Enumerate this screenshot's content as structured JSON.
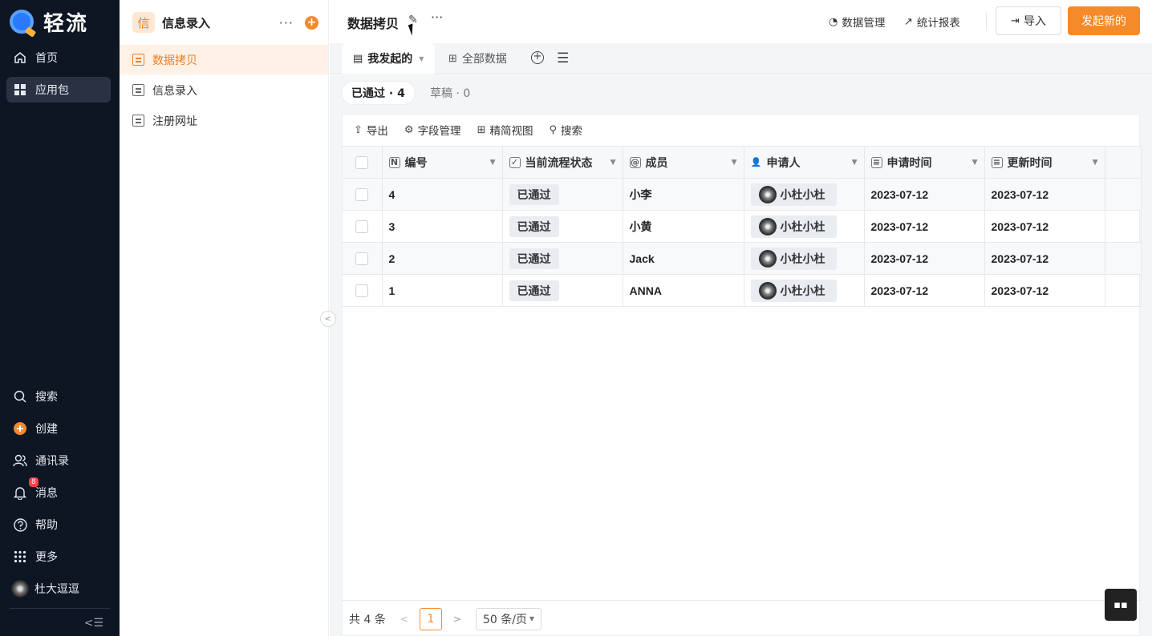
{
  "brand": {
    "name": "轻流"
  },
  "nav": {
    "items": [
      {
        "label": "首页",
        "icon": "home-icon"
      },
      {
        "label": "应用包",
        "icon": "grid-icon",
        "active": true
      }
    ],
    "bottom": [
      {
        "label": "搜索",
        "icon": "search-icon"
      },
      {
        "label": "创建",
        "icon": "plus-circle-icon"
      },
      {
        "label": "通讯录",
        "icon": "contacts-icon"
      },
      {
        "label": "消息",
        "icon": "bell-icon",
        "badge": "8"
      },
      {
        "label": "帮助",
        "icon": "help-icon"
      },
      {
        "label": "更多",
        "icon": "apps-icon"
      },
      {
        "label": "杜大逗逗",
        "icon": "avatar"
      }
    ]
  },
  "side": {
    "app_icon": "信",
    "title": "信息录入",
    "items": [
      {
        "label": "数据拷贝",
        "active": true
      },
      {
        "label": "信息录入"
      },
      {
        "label": "注册网址"
      }
    ]
  },
  "topbar": {
    "title": "数据拷贝",
    "data_manage": "数据管理",
    "report": "统计报表",
    "import": "导入",
    "new": "发起新的"
  },
  "tabs": [
    {
      "label": "我发起的",
      "active": true
    },
    {
      "label": "全部数据"
    }
  ],
  "chips": {
    "approved": "已通过 · 4",
    "draft": "草稿 · 0"
  },
  "toolbar": {
    "export": "导出",
    "fields": "字段管理",
    "simple_view": "精简视图",
    "search": "搜索"
  },
  "table": {
    "headers": [
      "编号",
      "当前流程状态",
      "成员",
      "申请人",
      "申请时间",
      "更新时间"
    ],
    "rows": [
      {
        "id": "4",
        "status": "已通过",
        "member": "小李",
        "applicant": "小杜小杜",
        "applied": "2023-07-12",
        "updated": "2023-07-12"
      },
      {
        "id": "3",
        "status": "已通过",
        "member": "小黄",
        "applicant": "小杜小杜",
        "applied": "2023-07-12",
        "updated": "2023-07-12"
      },
      {
        "id": "2",
        "status": "已通过",
        "member": "Jack",
        "applicant": "小杜小杜",
        "applied": "2023-07-12",
        "updated": "2023-07-12"
      },
      {
        "id": "1",
        "status": "已通过",
        "member": "ANNA",
        "applicant": "小杜小杜",
        "applied": "2023-07-12",
        "updated": "2023-07-12"
      }
    ]
  },
  "pager": {
    "total": "共 4 条",
    "page": "1",
    "size": "50 条/页"
  },
  "colors": {
    "accent": "#f58a2a",
    "nav_bg": "#0e1523"
  }
}
